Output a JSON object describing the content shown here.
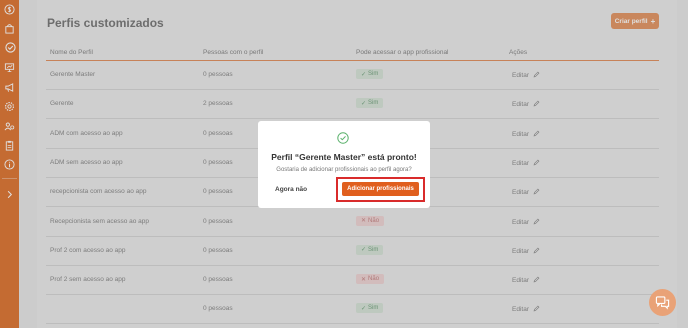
{
  "page": {
    "title": "Perfis customizados",
    "create_button": "Criar perfil",
    "create_icon": "+"
  },
  "table": {
    "headers": [
      "Nome do Perfil",
      "Pessoas com o perfil",
      "Pode acessar o app profissional",
      "Ações"
    ],
    "rows": [
      {
        "name": "Gerente Master",
        "people": "0 pessoas",
        "access": "Sim",
        "action": "Editar"
      },
      {
        "name": "Gerente",
        "people": "2 pessoas",
        "access": "Sim",
        "action": "Editar"
      },
      {
        "name": "ADM com acesso ao app",
        "people": "0 pessoas",
        "access": "",
        "action": "Editar"
      },
      {
        "name": "ADM sem acesso ao app",
        "people": "0 pessoas",
        "access": "",
        "action": "Editar"
      },
      {
        "name": "recepcionista com acesso ao app",
        "people": "0 pessoas",
        "access": "",
        "action": "Editar"
      },
      {
        "name": "Recepcionista sem acesso ao app",
        "people": "0 pessoas",
        "access": "Não",
        "action": "Editar"
      },
      {
        "name": "Prof 2 com acesso ao app",
        "people": "0 pessoas",
        "access": "Sim",
        "action": "Editar"
      },
      {
        "name": "Prof 2 sem acesso ao app",
        "people": "0 pessoas",
        "access": "Não",
        "action": "Editar"
      },
      {
        "name": "",
        "people": "0 pessoas",
        "access": "Sim",
        "action": "Editar"
      }
    ]
  },
  "modal": {
    "title": "Perfil “Gerente Master” está pronto!",
    "question": "Gostaria de adicionar profissionais ao perfil agora?",
    "secondary_button": "Agora não",
    "primary_button": "Adicionar profissionais"
  },
  "colors": {
    "brand": "#e07a3a",
    "primary_button": "#e05f1e",
    "highlight": "#d92b2b",
    "yes": "#7aa885",
    "no": "#c98b8b"
  },
  "sidebar": {
    "icons": [
      "dollar-icon",
      "shopping-bag-icon",
      "check-circle-icon",
      "presentation-icon",
      "megaphone-icon",
      "gear-icon",
      "users-gear-icon",
      "clipboard-icon",
      "info-icon",
      "chevron-right-icon"
    ]
  }
}
